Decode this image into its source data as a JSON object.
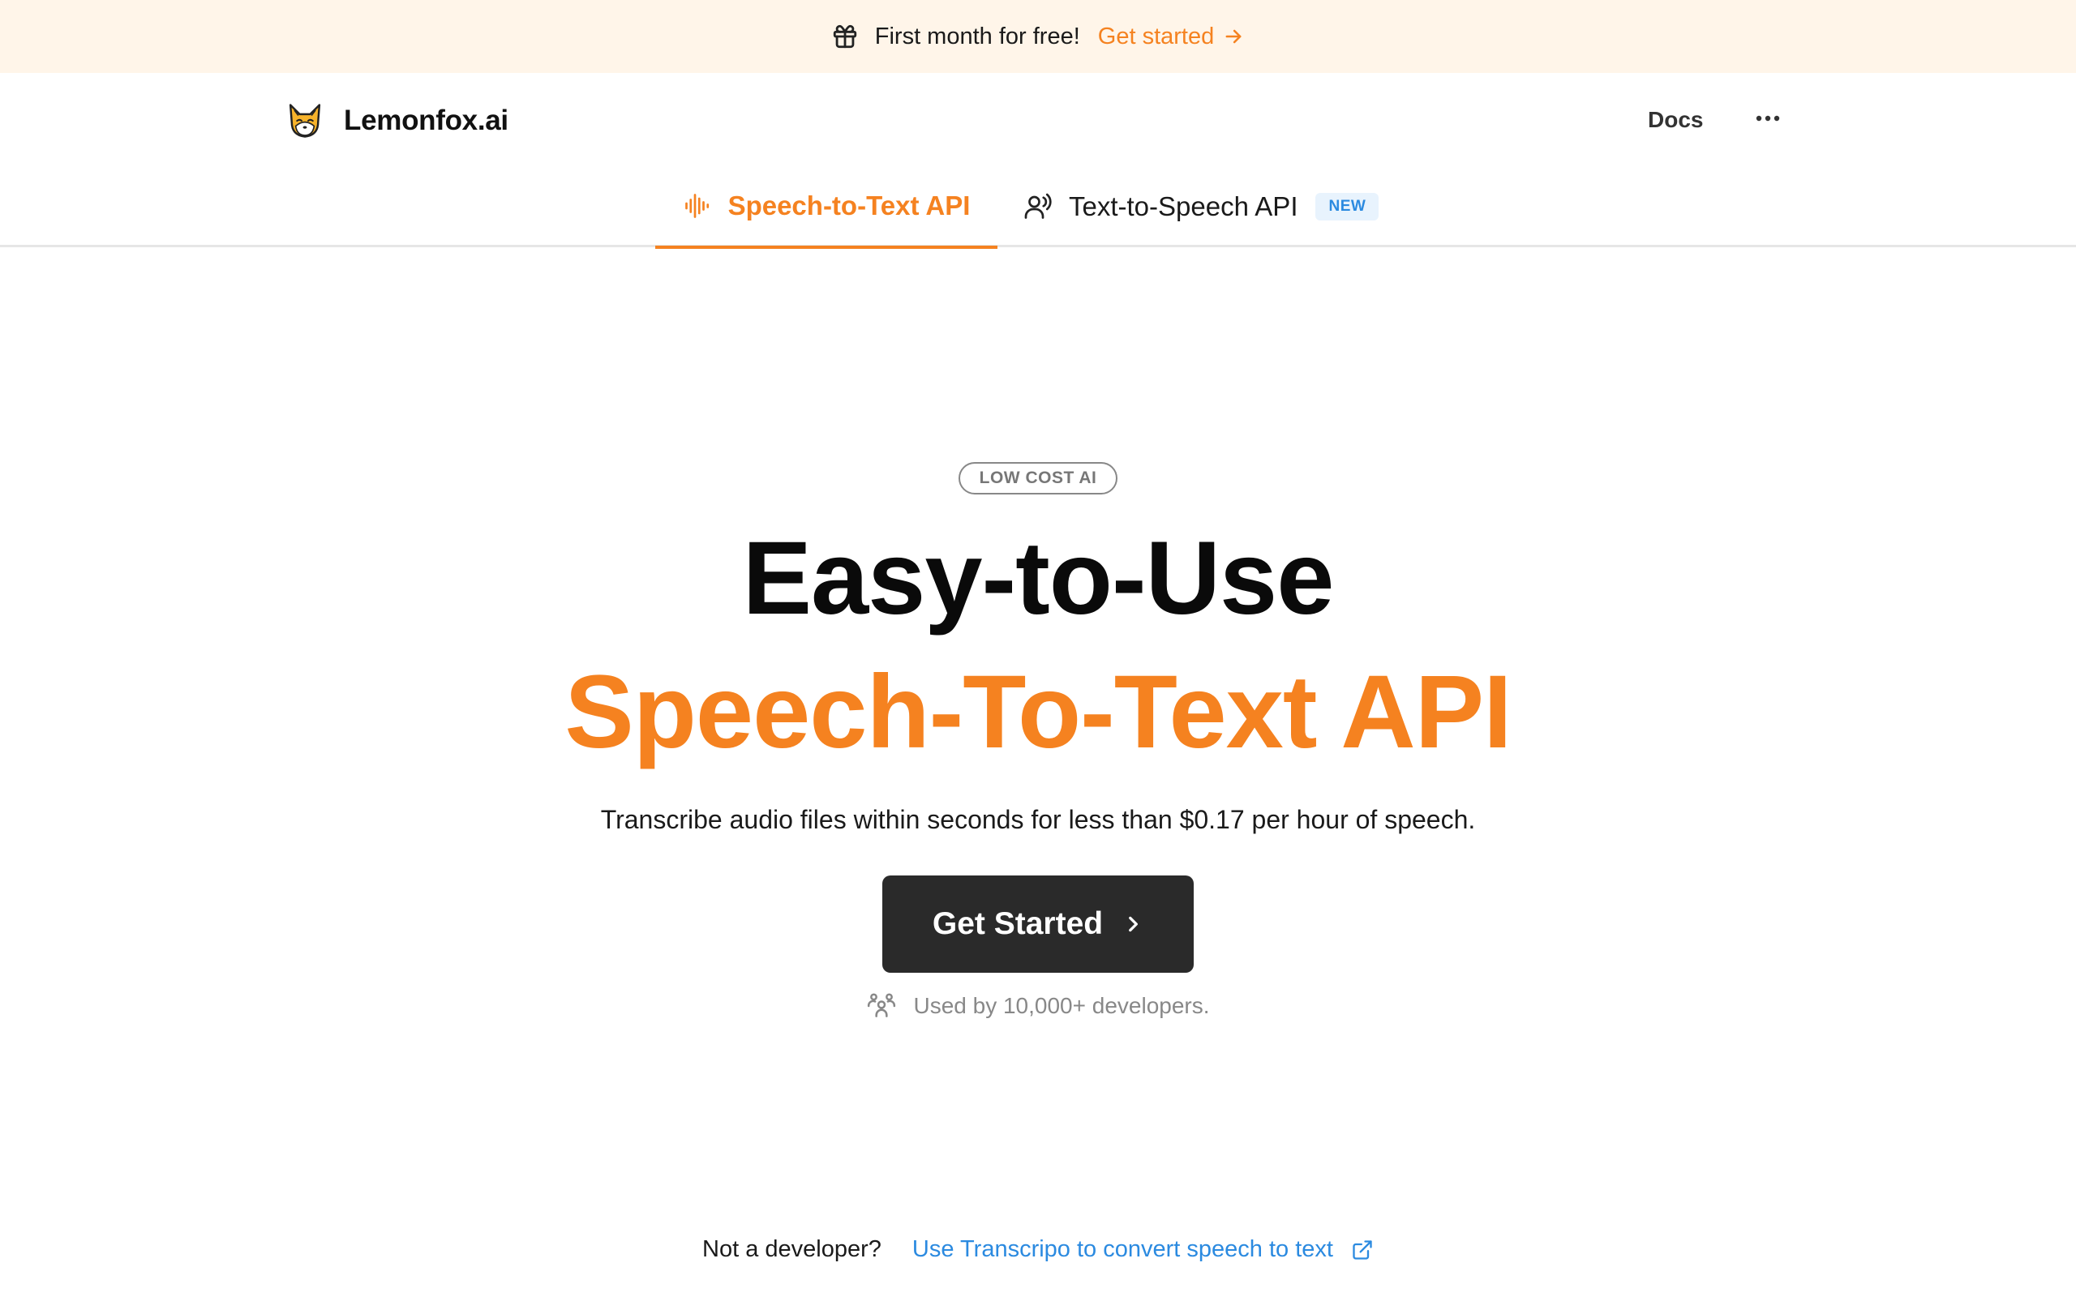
{
  "banner": {
    "message": "First month for free!",
    "cta": "Get started",
    "icon": "gift-icon"
  },
  "nav": {
    "brand": "Lemonfox.ai",
    "logo_icon": "fox-logo-icon",
    "docs": "Docs",
    "more_icon": "ellipsis-icon"
  },
  "tabs": [
    {
      "label": "Speech-to-Text API",
      "icon": "audio-wave-icon",
      "active": true
    },
    {
      "label": "Text-to-Speech API",
      "icon": "person-speaking-icon",
      "badge": "NEW",
      "active": false
    }
  ],
  "hero": {
    "pill": "LOW COST AI",
    "title_line1": "Easy-to-Use",
    "title_line2": "Speech-To-Text API",
    "subtitle": "Transcribe audio files within seconds for less than $0.17 per hour of speech.",
    "button": "Get Started",
    "social_proof": "Used by 10,000+ developers."
  },
  "footer_note": {
    "question": "Not a developer?",
    "link": "Use Transcripo to convert speech to text"
  },
  "colors": {
    "accent": "#f58220",
    "banner_bg": "#fff5e9",
    "button_bg": "#2a2a2a",
    "link": "#2b8ae0",
    "badge_bg": "#e8f3fd"
  }
}
